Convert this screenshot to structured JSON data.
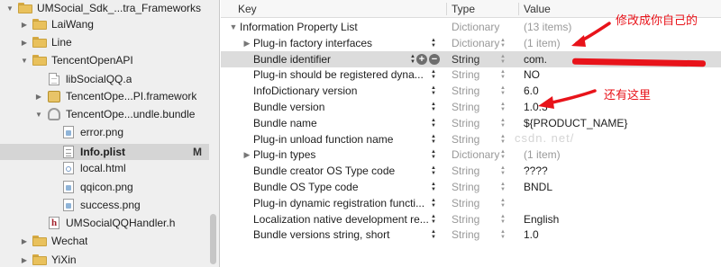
{
  "navigator": {
    "items": [
      {
        "label": "UMSocial_Sdk_...tra_Frameworks",
        "icon": "folder-icon",
        "disclosure": "open"
      },
      {
        "label": "LaiWang",
        "icon": "folder-icon",
        "disclosure": "closed"
      },
      {
        "label": "Line",
        "icon": "folder-icon",
        "disclosure": "closed"
      },
      {
        "label": "TencentOpenAPI",
        "icon": "folder-icon",
        "disclosure": "open"
      },
      {
        "label": "libSocialQQ.a",
        "icon": "file-icon",
        "disclosure": ""
      },
      {
        "label": "TencentOpe...PI.framework",
        "icon": "framework-icon",
        "disclosure": "closed"
      },
      {
        "label": "TencentOpe...undle.bundle",
        "icon": "bundle-icon",
        "disclosure": "open"
      },
      {
        "label": "error.png",
        "icon": "image-icon",
        "disclosure": ""
      },
      {
        "label": "Info.plist",
        "icon": "plist-icon",
        "disclosure": "",
        "badge": "M"
      },
      {
        "label": "local.html",
        "icon": "html-file-icon",
        "disclosure": ""
      },
      {
        "label": "qqicon.png",
        "icon": "image-icon",
        "disclosure": ""
      },
      {
        "label": "success.png",
        "icon": "image-icon",
        "disclosure": ""
      },
      {
        "label": "UMSocialQQHandler.h",
        "icon": "header-file-icon",
        "disclosure": ""
      },
      {
        "label": "Wechat",
        "icon": "folder-icon",
        "disclosure": "closed"
      },
      {
        "label": "YiXin",
        "icon": "folder-icon",
        "disclosure": "closed"
      }
    ]
  },
  "plist": {
    "headers": {
      "key": "Key",
      "type": "Type",
      "value": "Value"
    },
    "rows": [
      {
        "key": "Information Property List",
        "type": "Dictionary",
        "value": "(13 items)"
      },
      {
        "key": "Plug-in factory interfaces",
        "type": "Dictionary",
        "value": "(1 item)"
      },
      {
        "key": "Bundle identifier",
        "type": "String",
        "value": "com."
      },
      {
        "key": "Plug-in should be registered dyna...",
        "type": "String",
        "value": "NO"
      },
      {
        "key": "InfoDictionary version",
        "type": "String",
        "value": "6.0"
      },
      {
        "key": "Bundle version",
        "type": "String",
        "value": "1.0.3"
      },
      {
        "key": "Bundle name",
        "type": "String",
        "value": "${PRODUCT_NAME}"
      },
      {
        "key": "Plug-in unload function name",
        "type": "String",
        "value": ""
      },
      {
        "key": "Plug-in types",
        "type": "Dictionary",
        "value": "(1 item)"
      },
      {
        "key": "Bundle creator OS Type code",
        "type": "String",
        "value": "????"
      },
      {
        "key": "Bundle OS Type code",
        "type": "String",
        "value": "BNDL"
      },
      {
        "key": "Plug-in dynamic registration functi...",
        "type": "String",
        "value": ""
      },
      {
        "key": "Localization native development re...",
        "type": "String",
        "value": "English"
      },
      {
        "key": "Bundle versions string, short",
        "type": "String",
        "value": "1.0"
      }
    ]
  },
  "annotations": {
    "top": "修改成你自己的",
    "bottom": "还有这里",
    "watermark": "csdn. net/"
  },
  "colors": {
    "annotation_red": "#e8131a",
    "selected_row": "#dcdcdc",
    "sidebar_bg": "#efefef"
  }
}
